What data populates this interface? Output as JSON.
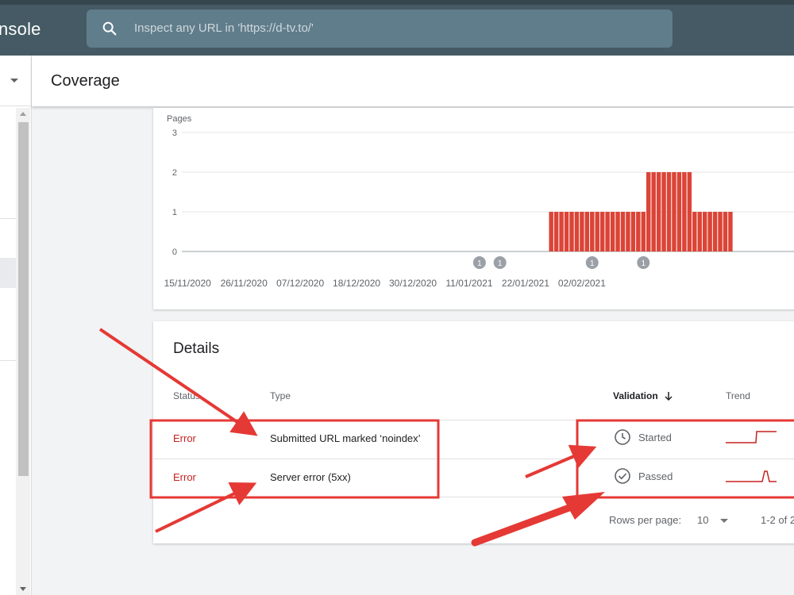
{
  "app": {
    "title_fragment": "nsole"
  },
  "search": {
    "placeholder": "Inspect any URL in 'https://d-tv.to/'"
  },
  "page": {
    "title": "Coverage"
  },
  "chart_data": {
    "type": "bar",
    "ylabel": "Pages",
    "ylim": [
      0,
      3
    ],
    "yticks": [
      0,
      1,
      2,
      3
    ],
    "x_tick_labels": [
      "15/11/2020",
      "26/11/2020",
      "07/12/2020",
      "18/12/2020",
      "30/12/2020",
      "11/01/2021",
      "22/01/2021",
      "02/02/2021"
    ],
    "start_date": "2020-11-15",
    "values": [
      0,
      0,
      0,
      0,
      0,
      0,
      0,
      0,
      0,
      0,
      0,
      0,
      0,
      0,
      0,
      0,
      0,
      0,
      0,
      0,
      0,
      0,
      0,
      0,
      0,
      0,
      0,
      0,
      0,
      0,
      0,
      0,
      0,
      0,
      0,
      0,
      0,
      0,
      0,
      0,
      0,
      0,
      0,
      0,
      0,
      0,
      0,
      0,
      0,
      0,
      0,
      0,
      0,
      0,
      0,
      0,
      0,
      0,
      0,
      0,
      0,
      0,
      0,
      0,
      0,
      0,
      0,
      0,
      0,
      0,
      0,
      1,
      1,
      1,
      1,
      1,
      1,
      1,
      1,
      1,
      1,
      1,
      1,
      1,
      1,
      1,
      1,
      1,
      1,
      1,
      2,
      2,
      2,
      2,
      2,
      2,
      2,
      2,
      2,
      1,
      1,
      1,
      1,
      1,
      1,
      1,
      1
    ],
    "bar_color": "#db4437",
    "annotations": [
      {
        "date": "2021-01-11",
        "label": "1"
      },
      {
        "date": "2021-01-15",
        "label": "1"
      },
      {
        "date": "2021-02-02",
        "label": "1"
      },
      {
        "date": "2021-02-12",
        "label": "1"
      }
    ],
    "grid": true
  },
  "details": {
    "title": "Details",
    "columns": {
      "status": "Status",
      "type": "Type",
      "validation": "Validation",
      "trend": "Trend"
    },
    "rows": [
      {
        "status": "Error",
        "type": "Submitted URL marked ‘noindex’",
        "validation": "Started",
        "validation_icon": "clock-icon"
      },
      {
        "status": "Error",
        "type": "Server error (5xx)",
        "validation": "Passed",
        "validation_icon": "check-circle-icon"
      }
    ],
    "pagination": {
      "rows_per_page_label": "Rows per page:",
      "rows_per_page": "10",
      "range": "1-2 of 2"
    }
  },
  "colors": {
    "error": "#c5221f",
    "annotation_red": "#e53935",
    "topbar": "#455a64"
  }
}
